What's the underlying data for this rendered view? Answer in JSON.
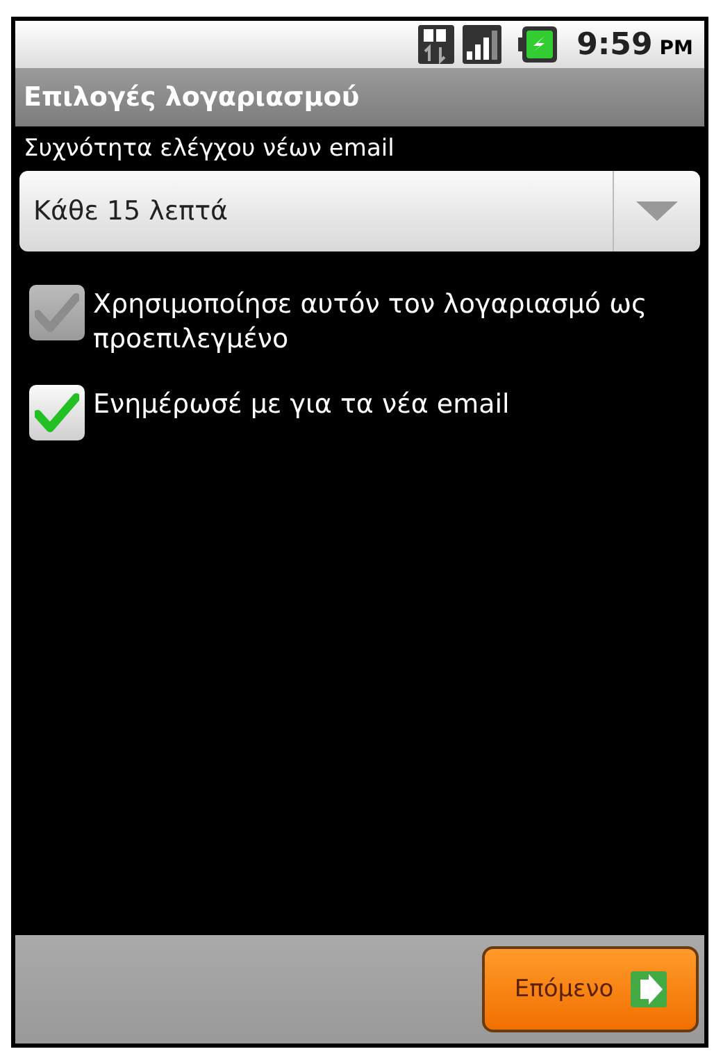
{
  "status_bar": {
    "time": "9:59",
    "meridiem": "PM"
  },
  "title": "Επιλογές λογαριασμού",
  "frequency": {
    "label": "Συχνότητα ελέγχου νέων email",
    "value": "Κάθε 15 λεπτά"
  },
  "options": [
    {
      "label": "Χρησιμοποίησε αυτόν τον λογαριασμό ως προεπιλεγμένο",
      "checked": true,
      "disabled": true
    },
    {
      "label": "Ενημέρωσέ με για τα νέα email",
      "checked": true,
      "disabled": false
    }
  ],
  "next_button": {
    "label": "Επόμενο",
    "disabled": false
  }
}
